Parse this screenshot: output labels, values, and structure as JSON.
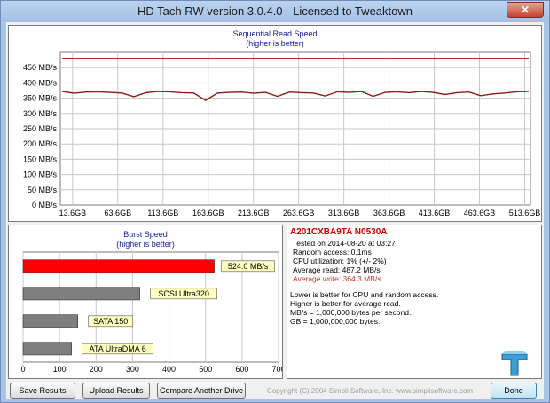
{
  "window": {
    "title": "HD Tach RW version 3.0.4.0 - Licensed to Tweaktown",
    "close_glyph": "✕"
  },
  "sequential_chart": {
    "title": "Sequential Read Speed",
    "subtitle": "(higher is better)",
    "y_ticks": [
      "450 MB/s",
      "400 MB/s",
      "350 MB/s",
      "300 MB/s",
      "250 MB/s",
      "200 MB/s",
      "150 MB/s",
      "100 MB/s",
      "50 MB/s",
      "0 MB/s"
    ],
    "x_ticks": [
      "13.6GB",
      "63.6GB",
      "113.6GB",
      "163.6GB",
      "213.6GB",
      "263.6GB",
      "313.6GB",
      "363.6GB",
      "413.6GB",
      "463.6GB",
      "513.6GB"
    ]
  },
  "burst_chart": {
    "title": "Burst Speed",
    "subtitle": "(higher is better)",
    "x_ticks": [
      "0",
      "100",
      "200",
      "300",
      "400",
      "500",
      "600",
      "700"
    ]
  },
  "chart_data": [
    {
      "type": "line",
      "title": "Sequential Read Speed",
      "subtitle": "(higher is better)",
      "xlabel": "",
      "ylabel": "",
      "ylim": [
        0,
        500
      ],
      "x_range_gb": [
        0,
        520
      ],
      "grid": true,
      "series": [
        {
          "values": [
            480,
            480,
            480,
            480,
            480,
            480,
            480,
            480,
            480,
            480,
            480,
            480,
            480,
            480,
            480,
            480,
            480,
            480,
            480,
            480,
            480,
            480,
            480,
            480,
            480,
            480,
            480,
            480,
            480,
            480,
            480,
            480,
            480,
            480,
            480,
            480,
            480,
            480,
            480,
            480
          ],
          "color": "#c00000"
        },
        {
          "values": [
            372,
            366,
            370,
            371,
            369,
            367,
            355,
            368,
            372,
            371,
            368,
            367,
            343,
            367,
            369,
            370,
            366,
            369,
            356,
            370,
            368,
            367,
            357,
            371,
            369,
            372,
            356,
            369,
            371,
            368,
            372,
            369,
            362,
            368,
            370,
            358,
            364,
            367,
            371,
            372
          ],
          "color": "#8b1a1a"
        }
      ]
    },
    {
      "type": "bar",
      "title": "Burst Speed",
      "subtitle": "(higher is better)",
      "xlim": [
        0,
        700
      ],
      "categories": [
        "524.0 MB/s",
        "SCSI Ultra320",
        "SATA 150",
        "ATA UltraDMA 6"
      ],
      "values": [
        524,
        320,
        150,
        133
      ],
      "colors": [
        "#ff0000",
        "#7f7f7f",
        "#7f7f7f",
        "#7f7f7f"
      ]
    }
  ],
  "info": {
    "drive": "A201CXBA9TA N0530A",
    "tested": "Tested on 2014-08-20 at 03:27",
    "random_access": "Random access: 0.1ms",
    "cpu": "CPU utilization: 1% (+/- 2%)",
    "avg_read": "Average read: 487.2 MB/s",
    "avg_write": "Average write: 364.3 MB/s",
    "note1": "Lower is better for CPU and random access.",
    "note2": "Higher is better for average read.",
    "note3": "MB/s = 1,000,000 bytes per second.",
    "note4": "GB = 1,000,000,000 bytes."
  },
  "buttons": {
    "save": "Save Results",
    "upload": "Upload Results",
    "compare": "Compare Another Drive",
    "done": "Done"
  },
  "copyright": "Copyright (C) 2004 Simpli Software, Inc. www.simplisoftware.com",
  "colors": {
    "read_line": "#8b1a1a",
    "top_line": "#c00000",
    "burst_bar": "#ff0000",
    "ref_bar": "#7f7f7f",
    "label_box": "#ffffc0"
  }
}
